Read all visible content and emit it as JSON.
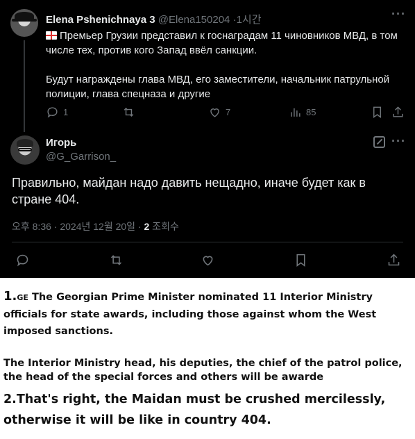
{
  "tweet1": {
    "author_name": "Elena Pshenichnaya 3",
    "author_handle": "@Elena150204",
    "time": "1시간",
    "flag_icon": "georgia-flag-icon",
    "text_line1": "Премьер Грузии представил к госнаградам 11 чиновников МВД, в том числе тех, против кого Запад ввёл санкции.",
    "text_line2": "Будут награждены глава МВД, его заместители, начальник патрульной полиции, глава спецназа и другие",
    "replies": "1",
    "likes": "7",
    "views": "85"
  },
  "tweet2": {
    "author_name": "Игорь",
    "author_handle": "@G_Garrison_",
    "text": "Правильно, майдан надо давить нещадно, иначе будет как в стране 404.",
    "timestamp": "오후 8:36 · 2024년 12월 20일 · ",
    "views_count": "2",
    "views_label": " 조회수"
  },
  "translation": {
    "item1_number": "1.",
    "item1_flag": "GE",
    "item1_text": " The Georgian Prime Minister nominated 11 Interior Ministry officials for state awards, including those against whom the West imposed sanctions.",
    "item1_text2": "The Interior Ministry head, his deputies, the chief of the patrol police, the head of the special forces and others will be awarde",
    "item2_text": "2.That's right, the Maidan must be crushed mercilessly, otherwise it will be like in country 404."
  },
  "colors": {
    "background": "#000000",
    "text_primary": "#e7e9ea",
    "text_secondary": "#71767b",
    "divider": "#2f3336"
  }
}
